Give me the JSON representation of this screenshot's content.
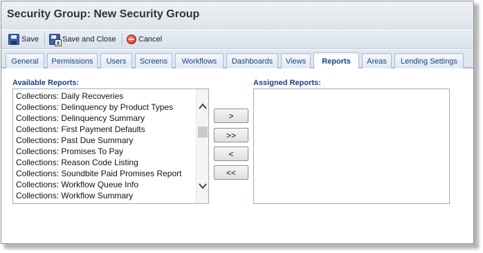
{
  "window": {
    "title": "Security Group: New Security Group"
  },
  "toolbar": {
    "save_label": "Save",
    "save_close_label": "Save and Close",
    "cancel_label": "Cancel"
  },
  "tabs": [
    {
      "label": "General"
    },
    {
      "label": "Permissions"
    },
    {
      "label": "Users"
    },
    {
      "label": "Screens"
    },
    {
      "label": "Workflows"
    },
    {
      "label": "Dashboards"
    },
    {
      "label": "Views"
    },
    {
      "label": "Reports",
      "active": true
    },
    {
      "label": "Areas"
    },
    {
      "label": "Lending Settings"
    }
  ],
  "available": {
    "label": "Available Reports:",
    "items": [
      "Collections: Daily Recoveries",
      "Collections: Delinquency by Product Types",
      "Collections: Delinquency Summary",
      "Collections: First Payment Defaults",
      "Collections: Past Due Summary",
      "Collections: Promises To Pay",
      "Collections: Reason Code Listing",
      "Collections: Soundbite Paid Promises Report",
      "Collections: Workflow Queue Info",
      "Collections: Workflow Summary"
    ]
  },
  "assigned": {
    "label": "Assigned Reports:",
    "items": []
  },
  "buttons": {
    "add_one": ">",
    "add_all": ">>",
    "remove_one": "<",
    "remove_all": "<<"
  },
  "colors": {
    "tab_text": "#15428b",
    "section_label": "#15428b",
    "cancel_icon": "#d0221a",
    "save_icon": "#3b5fa8"
  },
  "icons": {
    "save": "floppy-disk-icon",
    "save_close": "floppy-disk-close-icon",
    "cancel": "cancel-icon",
    "scroll_up": "chevron-up-icon",
    "scroll_down": "chevron-down-icon"
  }
}
